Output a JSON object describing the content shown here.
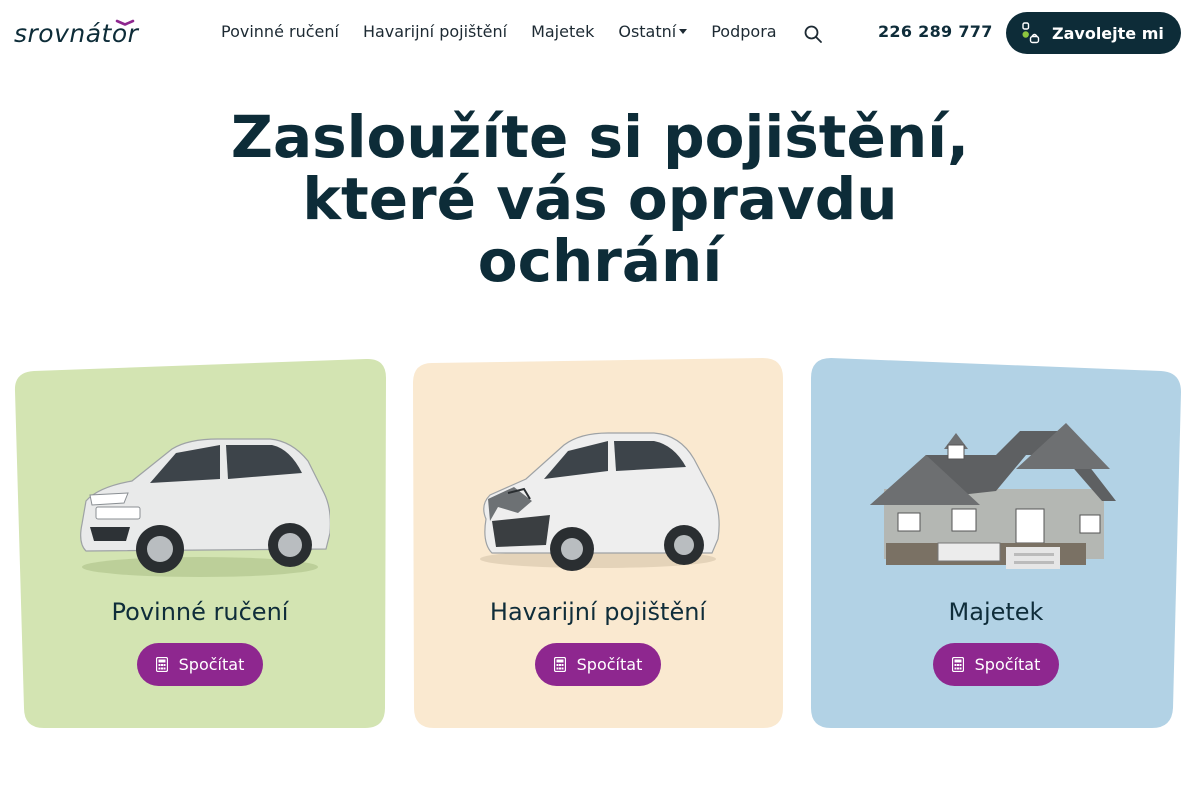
{
  "header": {
    "logo_text": "srovnátor",
    "nav": [
      {
        "label": "Povinné ručení"
      },
      {
        "label": "Havarijní pojištění"
      },
      {
        "label": "Majetek"
      },
      {
        "label": "Ostatní",
        "has_dropdown": true
      },
      {
        "label": "Podpora"
      }
    ],
    "search_icon": "search-icon",
    "phone": "226 289 777",
    "call_button": {
      "label": "Zavolejte mi",
      "icon": "phone-call-icon"
    }
  },
  "hero": {
    "title": "Zasloužíte si pojištění, které vás opravdu ochrání"
  },
  "cards": [
    {
      "label": "Povinné ručení",
      "button": "Spočítat",
      "image": "white-hatchback-car",
      "icon": "calculator-icon",
      "bg_color": "#d3e4b2"
    },
    {
      "label": "Havarijní pojištění",
      "button": "Spočítat",
      "image": "crashed-white-suv",
      "icon": "calculator-icon",
      "bg_color": "#fae9d0"
    },
    {
      "label": "Majetek",
      "button": "Spočítat",
      "image": "two-storey-house",
      "icon": "calculator-icon",
      "bg_color": "#b2d2e5"
    }
  ],
  "colors": {
    "primary_dark": "#0d2c38",
    "accent_purple": "#8e278f",
    "logo_purple": "#8e278f",
    "call_icon_green": "#8cc63f"
  }
}
